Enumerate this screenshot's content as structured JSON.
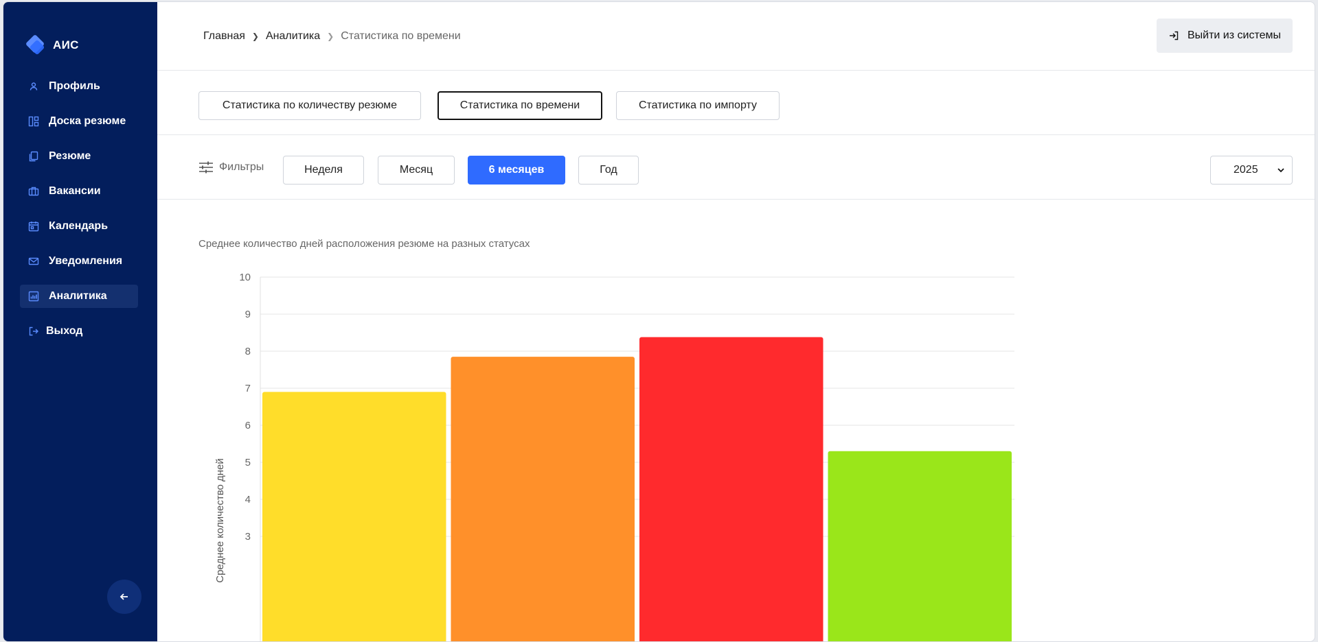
{
  "app": {
    "name": "АИС"
  },
  "sidebar": {
    "items": [
      {
        "label": "Профиль",
        "icon": "user-icon",
        "active": false
      },
      {
        "label": "Доска резюме",
        "icon": "board-icon",
        "active": false
      },
      {
        "label": "Резюме",
        "icon": "document-icon",
        "active": false
      },
      {
        "label": "Вакансии",
        "icon": "briefcase-icon",
        "active": false
      },
      {
        "label": "Календарь",
        "icon": "calendar-icon",
        "active": false
      },
      {
        "label": "Уведомления",
        "icon": "mail-icon",
        "active": false
      },
      {
        "label": "Аналитика",
        "icon": "chart-icon",
        "active": true
      }
    ],
    "logout_label": "Выход"
  },
  "header": {
    "breadcrumb": [
      "Главная",
      "Аналитика",
      "Статистика по времени"
    ],
    "logout_button": "Выйти из системы"
  },
  "tabs": [
    {
      "label": "Статистика по количеству резюме",
      "active": false
    },
    {
      "label": "Статистика по времени",
      "active": true
    },
    {
      "label": "Статистика по импорту",
      "active": false
    }
  ],
  "filters": {
    "label": "Фильтры",
    "periods": [
      {
        "label": "Неделя",
        "active": false
      },
      {
        "label": "Месяц",
        "active": false
      },
      {
        "label": "6 месяцев",
        "active": true
      },
      {
        "label": "Год",
        "active": false
      }
    ],
    "year": "2025"
  },
  "chart_data": {
    "type": "bar",
    "title": "Среднее количество дней расположения резюме на разных статусах",
    "ylabel": "Среднее количество дней",
    "xlabel": "",
    "ylim": [
      3,
      10
    ],
    "yticks": [
      10,
      9,
      8,
      7,
      6,
      5,
      4,
      3
    ],
    "grid": true,
    "values": [
      6.9,
      7.85,
      8.38,
      5.3
    ],
    "colors": [
      "#ffdd2a",
      "#ff902a",
      "#ff2a2d",
      "#9ae61a"
    ]
  }
}
